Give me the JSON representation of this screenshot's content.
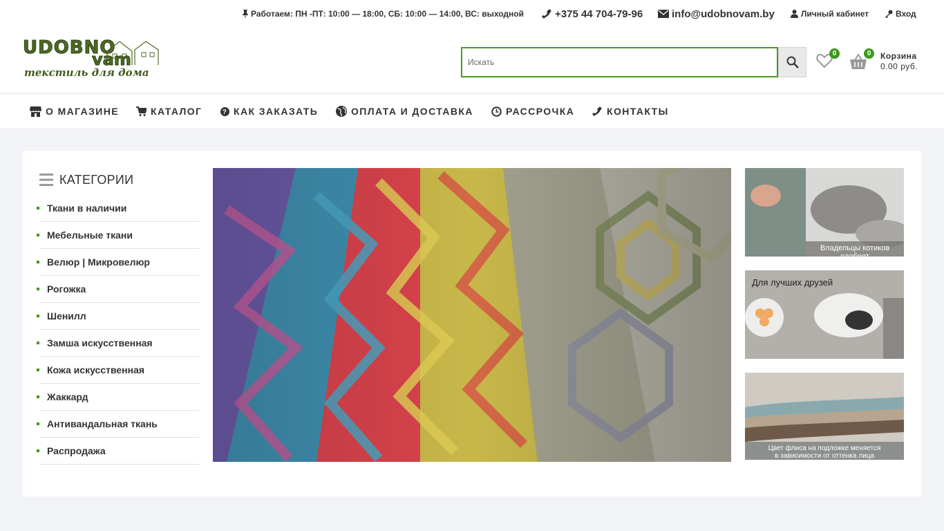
{
  "topbar": {
    "hours": "Работаем: ПН -ПТ: 10:00 — 18:00, СБ: 10:00 — 14:00, ВС: выходной",
    "phone": "+375 44 704-79-96",
    "email": "info@udobnovam.by",
    "cabinet": "Личный кабинет",
    "login": "Вход"
  },
  "logo": {
    "line1": "UDOBNO",
    "line2": "vam",
    "tagline": "текстиль для дома"
  },
  "search": {
    "placeholder": "Искать"
  },
  "wishlist": {
    "count": "0"
  },
  "cart": {
    "count": "0",
    "label": "Корзина",
    "total": "0.00 руб."
  },
  "nav": {
    "about": "О МАГАЗИНЕ",
    "catalog": "КАТАЛОГ",
    "how_to_order": "КАК ЗАКАЗАТЬ",
    "payment": "ОПЛАТА И ДОСТАВКА",
    "installment": "РАССРОЧКА",
    "contacts": "КОНТАКТЫ"
  },
  "categories": {
    "title": "КАТЕГОРИИ",
    "items": [
      "Ткани в наличии",
      "Мебельные ткани",
      "Велюр | Микровелюр",
      "Рогожка",
      "Шенилл",
      "Замша искусственная",
      "Кожа искусственная",
      "Жаккард",
      "Антивандальная ткань",
      "Распродажа"
    ]
  },
  "side_banners": {
    "b1_caption": "Владельцы котиков одобрят",
    "b2_caption": "Для лучших друзей",
    "b3_caption_1": "Цвет флиса на подложке меняется",
    "b3_caption_2": "в зависимости от оттенка лица"
  },
  "colors": {
    "accent": "#3c9a1a",
    "page_bg": "#f2f3f7",
    "logo_green": "#4d6a24"
  }
}
